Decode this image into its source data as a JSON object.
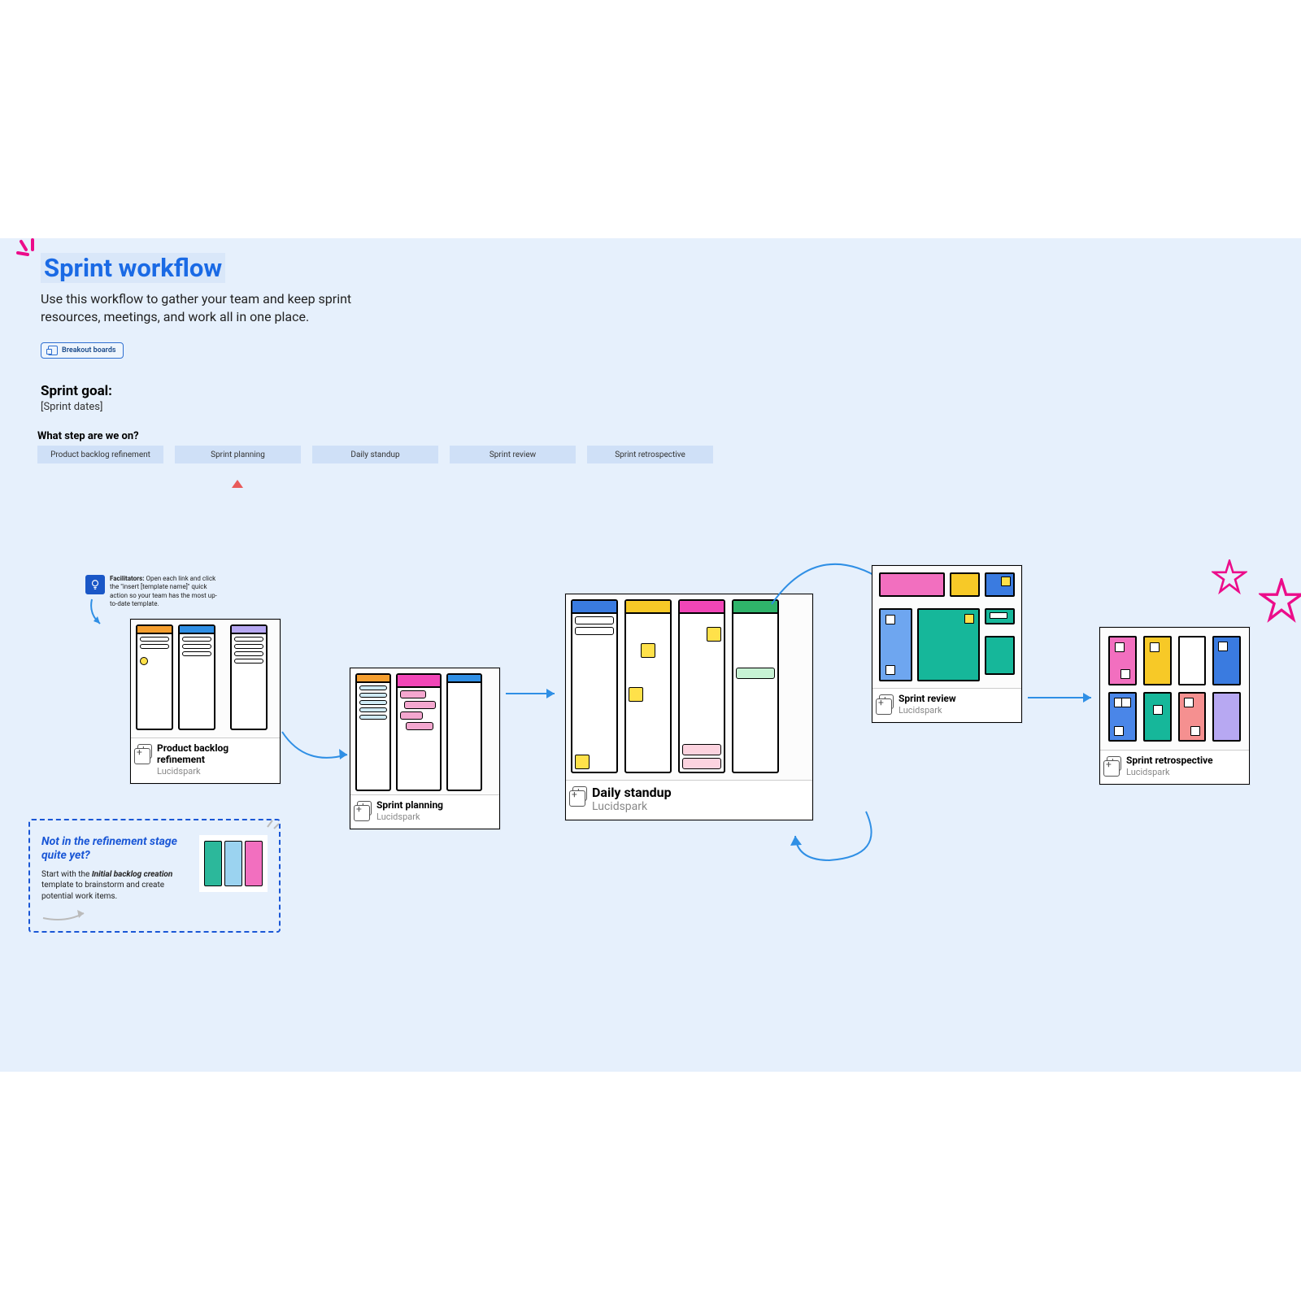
{
  "header": {
    "title": "Sprint workflow",
    "subtitle": "Use this workflow to gather your team and keep sprint resources, meetings, and work all in one place.",
    "breakout_label": "Breakout boards"
  },
  "goal": {
    "heading": "Sprint goal:",
    "dates": "[Sprint dates]"
  },
  "step_heading": "What step are we on?",
  "steps": [
    "Product backlog refinement",
    "Sprint planning",
    "Daily standup",
    "Sprint review",
    "Sprint retrospective"
  ],
  "current_step_index": 1,
  "facilitator": {
    "label": "Facilitators:",
    "text": "Open each link and click the \"insert [template name]\" quick action so your team has the most up-to-date template."
  },
  "cards": {
    "backlog": {
      "title": "Product backlog refinement",
      "source": "Lucidspark"
    },
    "planning": {
      "title": "Sprint planning",
      "source": "Lucidspark"
    },
    "standup": {
      "title": "Daily standup",
      "source": "Lucidspark"
    },
    "review": {
      "title": "Sprint review",
      "source": "Lucidspark"
    },
    "retro": {
      "title": "Sprint retrospective",
      "source": "Lucidspark"
    }
  },
  "helpbox": {
    "title": "Not in the refinement stage quite yet?",
    "lead": "Start with the ",
    "link": "Initial backlog creation",
    "tail": " template to brainstorm and create potential work items."
  },
  "colors": {
    "accent_blue": "#1a6ae5",
    "magenta": "#ec0c8a",
    "chip_bg": "#cfe0f7",
    "arrow": "#2f8fe5",
    "indicator": "#e85a5a"
  }
}
